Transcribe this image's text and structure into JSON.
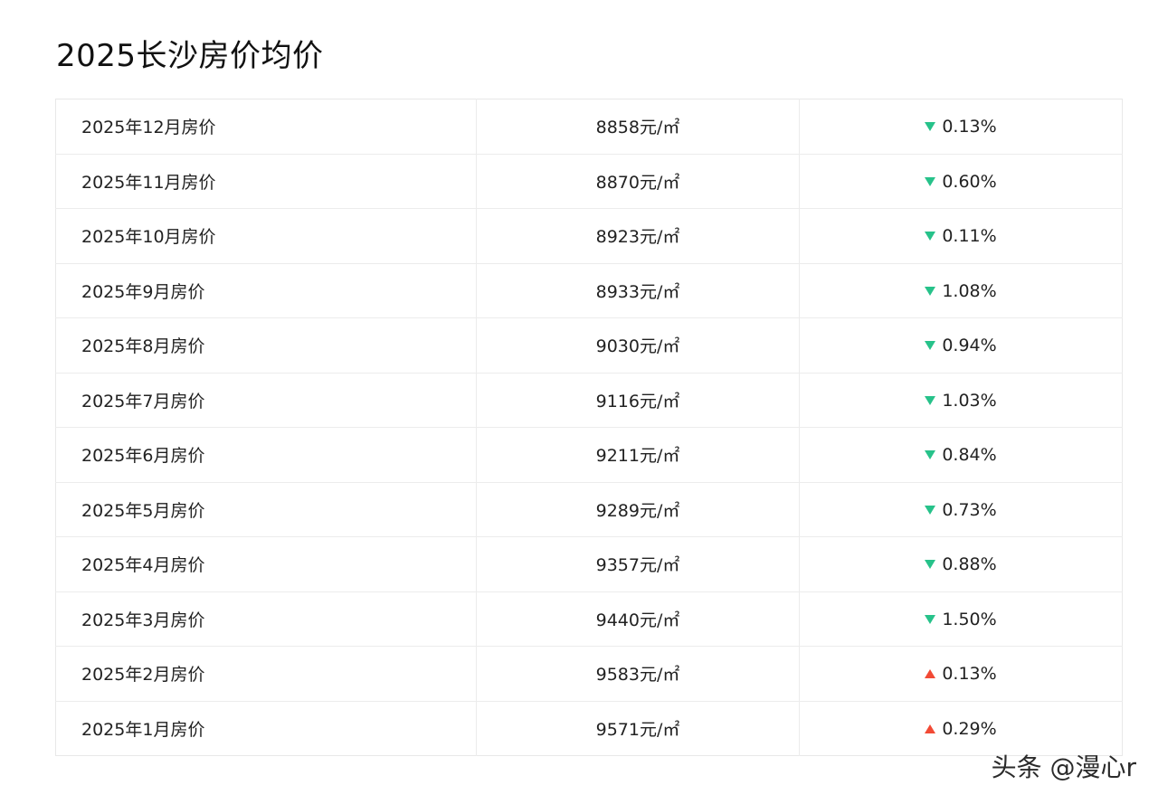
{
  "page": {
    "title": "2025长沙房价均价"
  },
  "colors": {
    "down": "#27c28a",
    "up": "#f24a35"
  },
  "rows": [
    {
      "month": "2025年12月房价",
      "price": "8858元/㎡",
      "change": "0.13%",
      "direction": "down"
    },
    {
      "month": "2025年11月房价",
      "price": "8870元/㎡",
      "change": "0.60%",
      "direction": "down"
    },
    {
      "month": "2025年10月房价",
      "price": "8923元/㎡",
      "change": "0.11%",
      "direction": "down"
    },
    {
      "month": "2025年9月房价",
      "price": "8933元/㎡",
      "change": "1.08%",
      "direction": "down"
    },
    {
      "month": "2025年8月房价",
      "price": "9030元/㎡",
      "change": "0.94%",
      "direction": "down"
    },
    {
      "month": "2025年7月房价",
      "price": "9116元/㎡",
      "change": "1.03%",
      "direction": "down"
    },
    {
      "month": "2025年6月房价",
      "price": "9211元/㎡",
      "change": "0.84%",
      "direction": "down"
    },
    {
      "month": "2025年5月房价",
      "price": "9289元/㎡",
      "change": "0.73%",
      "direction": "down"
    },
    {
      "month": "2025年4月房价",
      "price": "9357元/㎡",
      "change": "0.88%",
      "direction": "down"
    },
    {
      "month": "2025年3月房价",
      "price": "9440元/㎡",
      "change": "1.50%",
      "direction": "down"
    },
    {
      "month": "2025年2月房价",
      "price": "9583元/㎡",
      "change": "0.13%",
      "direction": "up"
    },
    {
      "month": "2025年1月房价",
      "price": "9571元/㎡",
      "change": "0.29%",
      "direction": "up"
    }
  ],
  "watermark": {
    "text": "头条 @漫心r"
  }
}
